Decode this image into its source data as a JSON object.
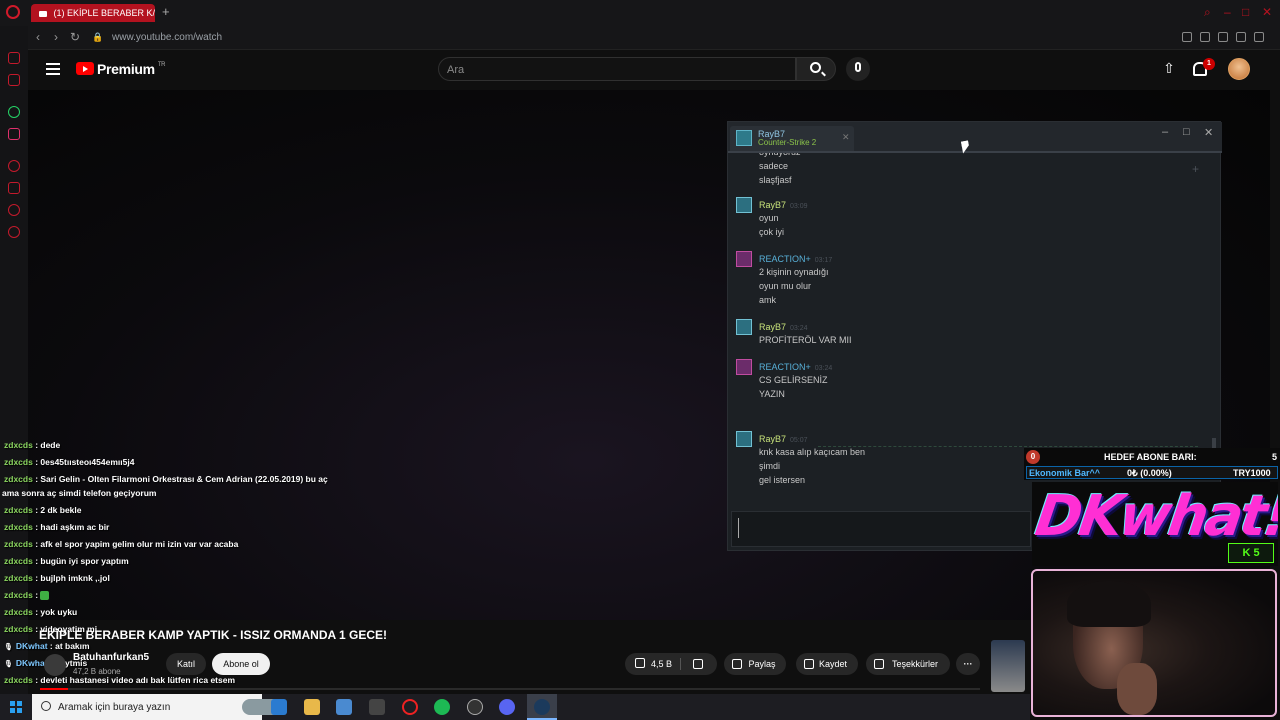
{
  "browser": {
    "tab_title": "(1) EKİPLE BERABER K/",
    "new_tab": "+",
    "url": "www.youtube.com/watch"
  },
  "youtube": {
    "brand": "Premium",
    "brand_sup": "TR",
    "search_placeholder": "Ara",
    "notification_count": "1",
    "video_title": "EKİPLE BERABER KAMP YAPTIK - ISSIZ ORMANDA 1 GECE!",
    "channel_name": "Batuhanfurkan5",
    "subscriber_count": "47,2 B abone",
    "join_label": "Katıl",
    "subscribe_label": "Abone ol",
    "likes": "4,5 B",
    "share_label": "Paylaş",
    "save_label": "Kaydet",
    "thanks_label": "Teşekkürler",
    "more_label": "···",
    "progress_percent": 0.03
  },
  "steam_chat": {
    "contact_name": "RayB7",
    "contact_game": "Counter-Strike 2",
    "messages": [
      {
        "sender": "",
        "time": "",
        "lines": [
          "oynuyoruz",
          "sadece",
          "slaşfjasf"
        ]
      },
      {
        "sender": "RayB7",
        "time": "03:09",
        "lines": [
          "oyun",
          "çok iyi"
        ]
      },
      {
        "sender": "REACTION+",
        "time": "03:17",
        "lines": [
          "2 kişinin oynadığı",
          "oyun mu olur",
          "amk"
        ]
      },
      {
        "sender": "RayB7",
        "time": "03:24",
        "lines": [
          "PROFİTERÖL VAR MII"
        ]
      },
      {
        "sender": "REACTION+",
        "time": "03:24",
        "lines": [
          "CS GELİRSENİZ",
          "YAZIN"
        ]
      },
      {
        "sender": "RayB7",
        "time": "05:07",
        "lines": [
          "knk kasa alıp kaçıcam ben",
          "şimdi",
          "gel istersen"
        ]
      }
    ],
    "input_value": ""
  },
  "stream_chat": [
    {
      "user": "zdxcds",
      "text": "dede"
    },
    {
      "user": "zdxcds",
      "text": "0es45tıısteoı454emıı5j4"
    },
    {
      "user": "zdxcds",
      "text": "Sari Gelin - Olten Filarmoni Orkestrası & Cem Adrian (22.05.2019) bu aç",
      "cont": "ama sonra aç simdi telefon geçiyorum"
    },
    {
      "user": "zdxcds",
      "text": "2 dk bekle"
    },
    {
      "user": "zdxcds",
      "text": "hadi aşkım ac bir"
    },
    {
      "user": "zdxcds",
      "text": "afk el spor yapim gelim olur mi izin var var acaba"
    },
    {
      "user": "zdxcds",
      "text": "bugün iyi spor yaptım"
    },
    {
      "user": "zdxcds",
      "text": "bujlph imknk ,.jol"
    },
    {
      "user": "zdxcds",
      "text": "",
      "emote": true
    },
    {
      "user": "zdxcds",
      "text": "yok uyku"
    },
    {
      "user": "zdxcds",
      "text": "videoyatim mi"
    },
    {
      "user": "DKwhat",
      "text": "at bakım"
    },
    {
      "user": "DKwhat",
      "text": "neytmis"
    },
    {
      "user": "zdxcds",
      "text": "devleti hastanesi video adı bak lütfen rica etsem"
    },
    {
      "user": "zdxcds",
      "text": "okwe"
    }
  ],
  "overlay": {
    "goal_current": "0",
    "goal_title": "HEDEF ABONE BARI:",
    "goal_target": "5",
    "goal_bar_label": "Ekonomik Bar^^",
    "goal_percent_label": "0₺ (0.00%)",
    "goal_try": "TRY1000",
    "goal_fraction": 0.0,
    "logo_text": "DKwhat!",
    "kick_label": "K 5"
  },
  "taskbar": {
    "search_placeholder": "Aramak için buraya yazın"
  },
  "colors": {
    "opera_red": "#b3121f",
    "youtube_red": "#ff0000",
    "steam_bg": "#1c2024",
    "chat_user_green": "#8ad45f",
    "goal_blue": "#1e7fc4",
    "kick_green": "#53fc18"
  },
  "icons": [
    "opera-icon",
    "search-icon",
    "mic-icon",
    "upload-icon",
    "bell-icon",
    "like-icon",
    "dislike-icon",
    "share-icon",
    "save-icon",
    "thanks-icon",
    "windows-icon"
  ]
}
